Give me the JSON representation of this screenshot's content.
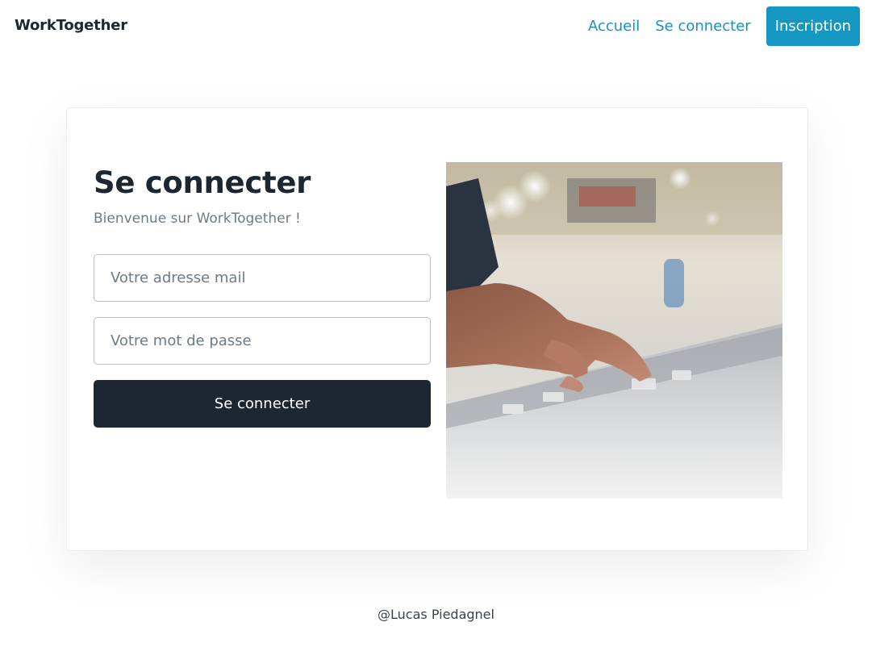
{
  "nav": {
    "brand": "WorkTogether",
    "links": [
      "Accueil",
      "Se connecter"
    ],
    "cta": "Inscription"
  },
  "login": {
    "title": "Se connecter",
    "subtitle": "Bienvenue sur WorkTogether !",
    "email_placeholder": "Votre adresse mail",
    "password_placeholder": "Votre mot de passe",
    "submit_label": "Se connecter"
  },
  "image": {
    "description_icon": "photo-mixing-console"
  },
  "footer": {
    "text": "@Lucas Piedagnel"
  },
  "colors": {
    "primary": "#1597c1",
    "dark": "#1c2731",
    "muted": "#6c7b86"
  }
}
